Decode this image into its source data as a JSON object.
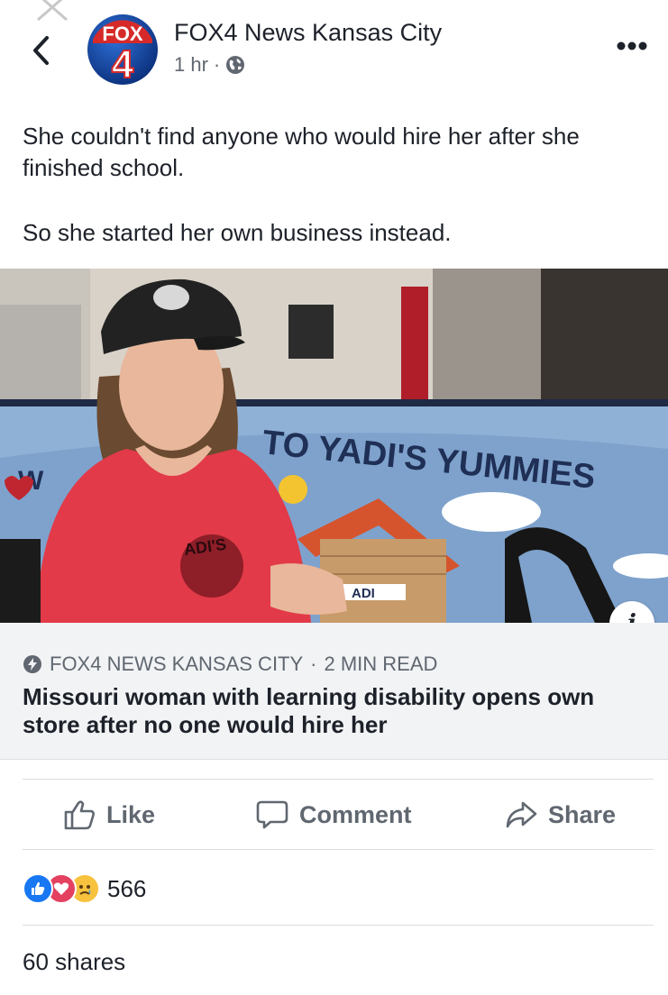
{
  "header": {
    "page_name": "FOX4 News Kansas City",
    "time": "1 hr",
    "separator": "·",
    "logo_text_top": "FOX",
    "logo_text_number": "4",
    "icons": {
      "close": "close-icon",
      "back": "back-chevron-icon",
      "privacy": "globe-icon",
      "more": "more-options-icon"
    }
  },
  "post": {
    "line1": "She couldn't find anyone who would hire her after she finished school.",
    "line2": "So she started her own business instead."
  },
  "image": {
    "sign_text": "TO YADI'S YUMMIES",
    "sign_text_left": "W",
    "doghouse_text": "ADI",
    "shirt_text": "ADI'S",
    "info_label": "i"
  },
  "link_card": {
    "source": "FOX4 NEWS KANSAS CITY",
    "separator": "·",
    "read_time": "2 MIN READ",
    "headline": "Missouri woman with learning disability opens own store after no one would hire her"
  },
  "actions": {
    "like": "Like",
    "comment": "Comment",
    "share": "Share"
  },
  "stats": {
    "reaction_count": "566",
    "reactions": [
      "like",
      "love",
      "sad"
    ],
    "shares": "60 shares"
  },
  "colors": {
    "brand_blue": "#1877f2",
    "love_red": "#e4405f",
    "sad_yellow": "#f7c23d",
    "card_bg": "#f2f3f5",
    "muted_text": "#606770"
  }
}
